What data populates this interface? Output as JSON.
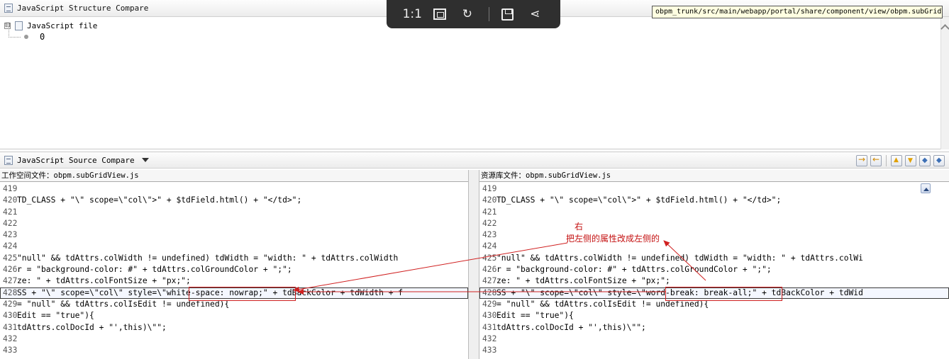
{
  "top_view": {
    "title": "JavaScript Structure Compare",
    "tree_root_label": "JavaScript file",
    "tree_child_value": "0",
    "expander_symbol": "⊟"
  },
  "viewer_toolbar": {
    "one_to_one": "1:1",
    "refresh": "↻",
    "share": "⋖"
  },
  "tooltip": {
    "path": "obpm_trunk/src/main/webapp/portal/share/component/view/obpm.subGridVi.w.js"
  },
  "compare_view": {
    "title": "JavaScript Source Compare"
  },
  "left_pane": {
    "title": "工作空间文件：obpm.subGridView.js",
    "lines": [
      {
        "num": "419",
        "text": ""
      },
      {
        "num": "420",
        "text": "TD_CLASS + \"\\\" scope=\\\"col\\\">\" + $tdField.html() + \"</td>\";"
      },
      {
        "num": "421",
        "text": ""
      },
      {
        "num": "422",
        "text": ""
      },
      {
        "num": "423",
        "text": ""
      },
      {
        "num": "424",
        "text": ""
      },
      {
        "num": "425",
        "text": "\"null\" && tdAttrs.colWidth != undefined) tdWidth = \"width: \" + tdAttrs.colWidth"
      },
      {
        "num": "426",
        "text": "r = \"background-color: #\" + tdAttrs.colGroundColor + \";\";"
      },
      {
        "num": "427",
        "text": "ze: \" + tdAttrs.colFontSize + \"px;\";"
      },
      {
        "num": "428",
        "text": "SS + \"\\\" scope=\\\"col\\\" style=\\\"white-space: nowrap;\" + tdBackColor + tdWidth + f"
      },
      {
        "num": "429",
        "text": "= \"null\" && tdAttrs.colIsEdit != undefined){"
      },
      {
        "num": "430",
        "text": "Edit == \"true\"){"
      },
      {
        "num": "431",
        "text": "tdAttrs.colDocId + \"',this)\\\"\";"
      },
      {
        "num": "432",
        "text": ""
      },
      {
        "num": "433",
        "text": ""
      }
    ]
  },
  "right_pane": {
    "title": "资源库文件：obpm.subGridView.js",
    "lines": [
      {
        "num": "419",
        "text": ""
      },
      {
        "num": "420",
        "text": "TD_CLASS + \"\\\" scope=\\\"col\\\">\" + $tdField.html() + \"</td>\";"
      },
      {
        "num": "421",
        "text": ""
      },
      {
        "num": "422",
        "text": ""
      },
      {
        "num": "423",
        "text": ""
      },
      {
        "num": "424",
        "text": ""
      },
      {
        "num": "425",
        "text": "\"null\" && tdAttrs.colWidth != undefined) tdWidth = \"width: \" + tdAttrs.colWi"
      },
      {
        "num": "426",
        "text": "r = \"background-color: #\" + tdAttrs.colGroundColor + \";\";"
      },
      {
        "num": "427",
        "text": "ze: \" + tdAttrs.colFontSize + \"px;\";"
      },
      {
        "num": "428",
        "text": "SS + \"\\\" scope=\\\"col\\\" style=\\\"word-break: break-all;\" + tdBackColor + tdWid"
      },
      {
        "num": "429",
        "text": "= \"null\" && tdAttrs.colIsEdit != undefined){"
      },
      {
        "num": "430",
        "text": "Edit == \"true\"){"
      },
      {
        "num": "431",
        "text": "tdAttrs.colDocId + \"',this)\\\"\";"
      },
      {
        "num": "432",
        "text": ""
      },
      {
        "num": "433",
        "text": ""
      }
    ]
  },
  "annotation": {
    "line1": "右",
    "line2": "把左侧的属性改成左侧的",
    "color": "#c41010"
  }
}
